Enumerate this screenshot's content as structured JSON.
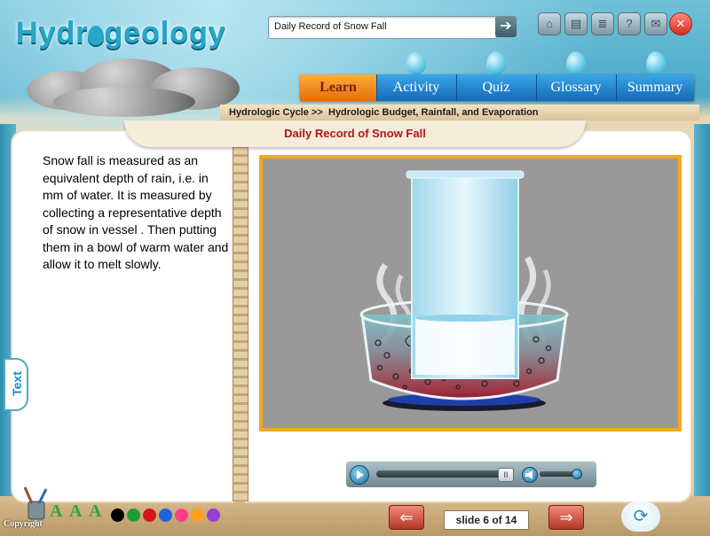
{
  "app": {
    "logo_text_left": "Hydr",
    "logo_text_right": "geology"
  },
  "search": {
    "value": "Daily Record of Snow Fall"
  },
  "nav": {
    "tabs": [
      {
        "label": "Learn",
        "active": true
      },
      {
        "label": "Activity",
        "active": false
      },
      {
        "label": "Quiz",
        "active": false
      },
      {
        "label": "Glossary",
        "active": false
      },
      {
        "label": "Summary",
        "active": false
      }
    ]
  },
  "breadcrumb": {
    "part1": "Hydrologic Cycle >>",
    "part2": "Hydrologic Budget, Rainfall, and Evaporation"
  },
  "page": {
    "title": "Daily Record of Snow Fall",
    "body": "Snow fall is measured as an equivalent depth of rain, i.e. in mm of water. It is measured by collecting a representative depth of snow in vessel . Then putting them in a bowl of warm water and allow it to melt slowly."
  },
  "side_tab": {
    "label": "Text"
  },
  "player": {
    "pause_label": "II"
  },
  "footer": {
    "slide_counter": "slide 6 of 14",
    "copyright": "Copyright",
    "font_letter": "A"
  },
  "colors": {
    "accent_orange": "#f4a81b",
    "title_red": "#b0161b",
    "nav_blue": "#1569b9",
    "swatches": [
      "#000000",
      "#1e9d35",
      "#d11919",
      "#1f5fe0",
      "#ff3b8a",
      "#ffa01c",
      "#9a3bd8"
    ]
  },
  "icons": {
    "tools": [
      "home-icon",
      "print-icon",
      "notes-icon",
      "help-icon",
      "mail-icon",
      "close-icon"
    ]
  }
}
